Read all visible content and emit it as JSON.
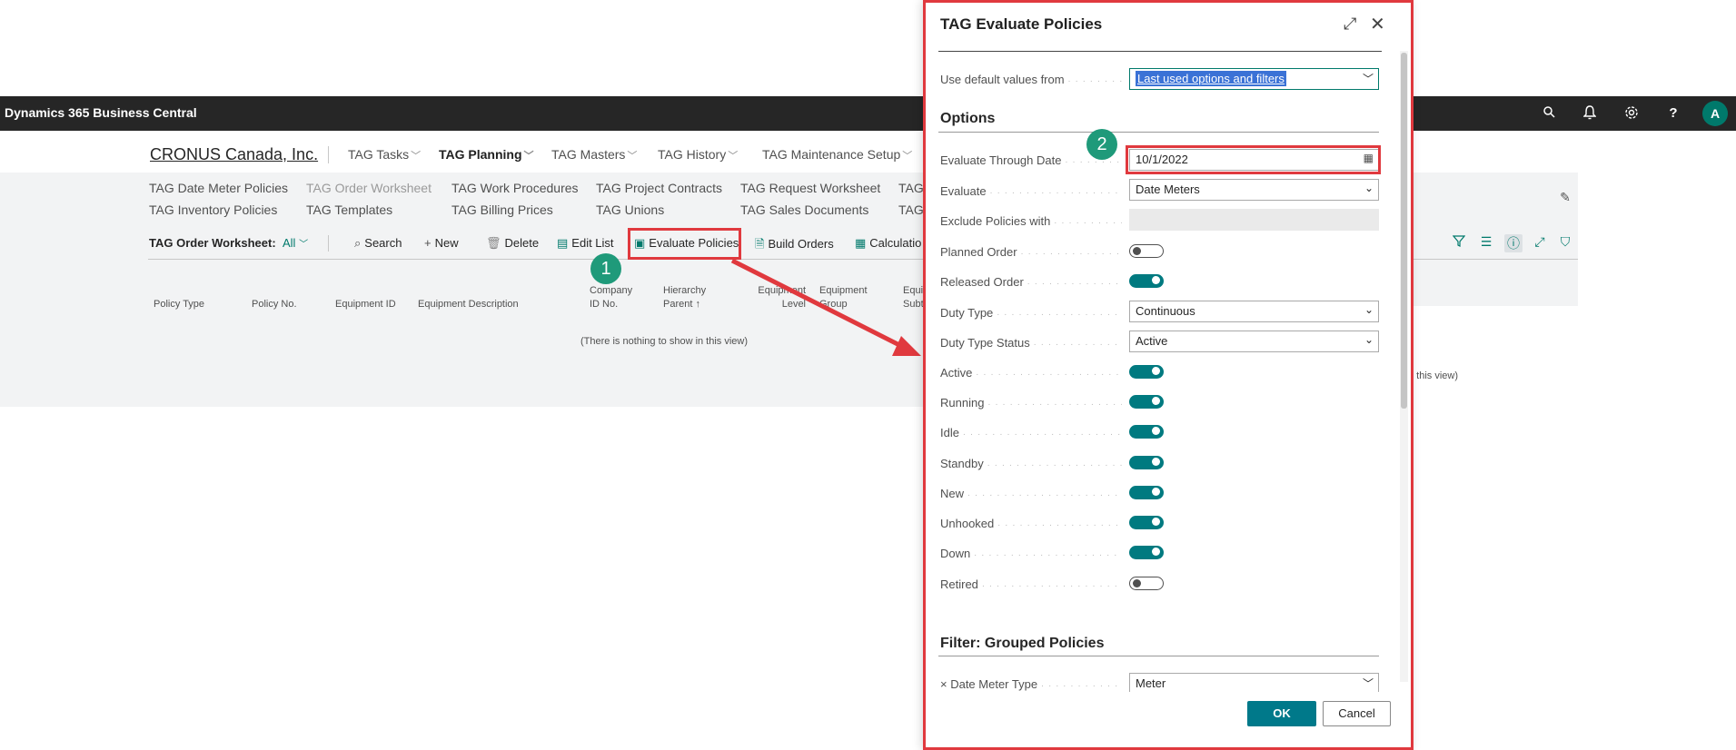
{
  "app": {
    "title": "Dynamics 365 Business Central",
    "avatar_initial": "A",
    "icons": [
      "search-icon",
      "bell-icon",
      "gear-icon",
      "help-icon"
    ]
  },
  "company": "CRONUS Canada, Inc.",
  "menus": [
    {
      "label": "TAG Tasks",
      "active": false
    },
    {
      "label": "TAG Planning",
      "active": true
    },
    {
      "label": "TAG Masters",
      "active": false
    },
    {
      "label": "TAG History",
      "active": false
    },
    {
      "label": "TAG Maintenance Setup",
      "active": false
    }
  ],
  "links": {
    "row1": [
      "TAG Date Meter Policies",
      "TAG Order Worksheet",
      "TAG Work Procedures",
      "TAG Project Contracts",
      "TAG Request Worksheet",
      "TAG"
    ],
    "row2": [
      "TAG Inventory Policies",
      "TAG Templates",
      "TAG Billing Prices",
      "TAG Unions",
      "TAG Sales Documents",
      "TAG"
    ]
  },
  "actionbar": {
    "view_label": "TAG Order Worksheet:",
    "view_value": "All",
    "actions": [
      "Search",
      "New",
      "Delete",
      "Edit List",
      "Evaluate Policies",
      "Build Orders",
      "Calculatio"
    ]
  },
  "columns": [
    "Policy Type",
    "Policy No.",
    "Equipment ID",
    "Equipment Description",
    "Company ID No.",
    "Hierarchy Parent ↑",
    "Equipment Level",
    "Equipment Group",
    "Equi Subt"
  ],
  "empty_text": "(There is nothing to show in this view)",
  "empty_text_right": "n this view)",
  "badges": [
    "1",
    "2"
  ],
  "dialog": {
    "title": "TAG Evaluate Policies",
    "default_values_label": "Use default values from",
    "default_values_value": "Last used options and filters",
    "options_heading": "Options",
    "fields": [
      {
        "label": "Evaluate Through Date",
        "value": "10/1/2022"
      },
      {
        "label": "Evaluate",
        "value": "Date Meters"
      },
      {
        "label": "Exclude Policies with",
        "value": ""
      }
    ],
    "toggles": [
      {
        "label": "Planned Order",
        "on": false
      },
      {
        "label": "Released Order",
        "on": true
      }
    ],
    "selects": [
      {
        "label": "Duty Type",
        "value": "Continuous"
      },
      {
        "label": "Duty Type Status",
        "value": "Active"
      }
    ],
    "status_toggles": [
      {
        "label": "Active",
        "on": true
      },
      {
        "label": "Running",
        "on": true
      },
      {
        "label": "Idle",
        "on": true
      },
      {
        "label": "Standby",
        "on": true
      },
      {
        "label": "New",
        "on": true
      },
      {
        "label": "Unhooked",
        "on": true
      },
      {
        "label": "Down",
        "on": true
      },
      {
        "label": "Retired",
        "on": false
      }
    ],
    "filter_heading": "Filter: Grouped Policies",
    "filter_row": {
      "label": "× Date Meter Type",
      "value": "Meter"
    },
    "ok": "OK",
    "cancel": "Cancel"
  }
}
